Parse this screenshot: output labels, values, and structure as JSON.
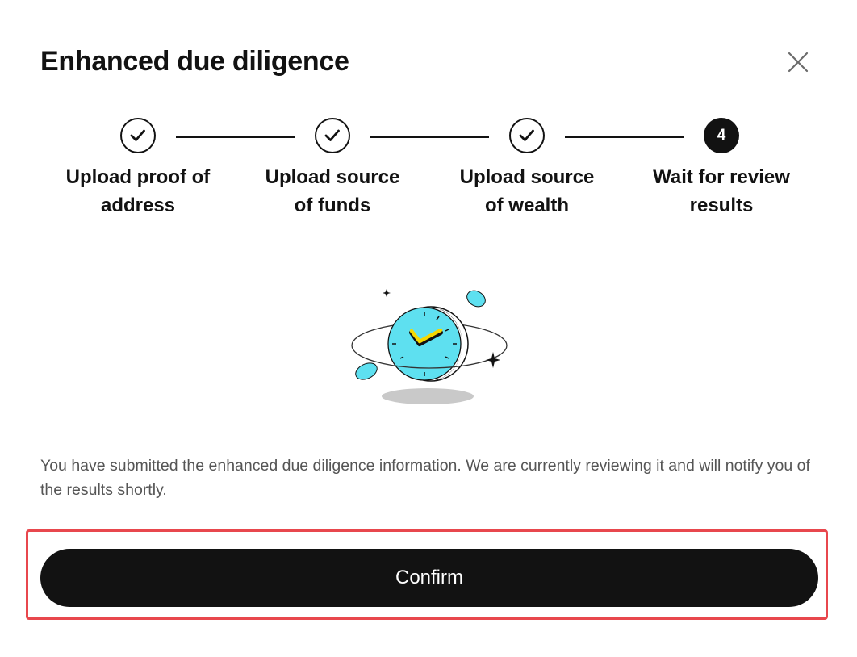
{
  "dialog": {
    "title": "Enhanced due diligence",
    "close_icon": "close-icon",
    "steps": [
      {
        "label_line1": "Upload proof of",
        "label_line2": "address",
        "status": "done",
        "icon": "check-icon"
      },
      {
        "label_line1": "Upload source",
        "label_line2": "of funds",
        "status": "done",
        "icon": "check-icon"
      },
      {
        "label_line1": "Upload source",
        "label_line2": "of wealth",
        "status": "done",
        "icon": "check-icon"
      },
      {
        "number": "4",
        "label_line1": "Wait for review",
        "label_line2": "results",
        "status": "current"
      }
    ],
    "illustration_icon": "clock-illustration",
    "message": "You have submitted the enhanced due diligence information. We are currently reviewing it and will notify you of the results shortly.",
    "confirm_label": "Confirm"
  },
  "colors": {
    "text_primary": "#121212",
    "text_secondary": "#555555",
    "button_background": "#121212",
    "highlight_border": "#e8474d",
    "illustration_accent": "#5ee0f0",
    "illustration_hand": "#f5d800"
  }
}
